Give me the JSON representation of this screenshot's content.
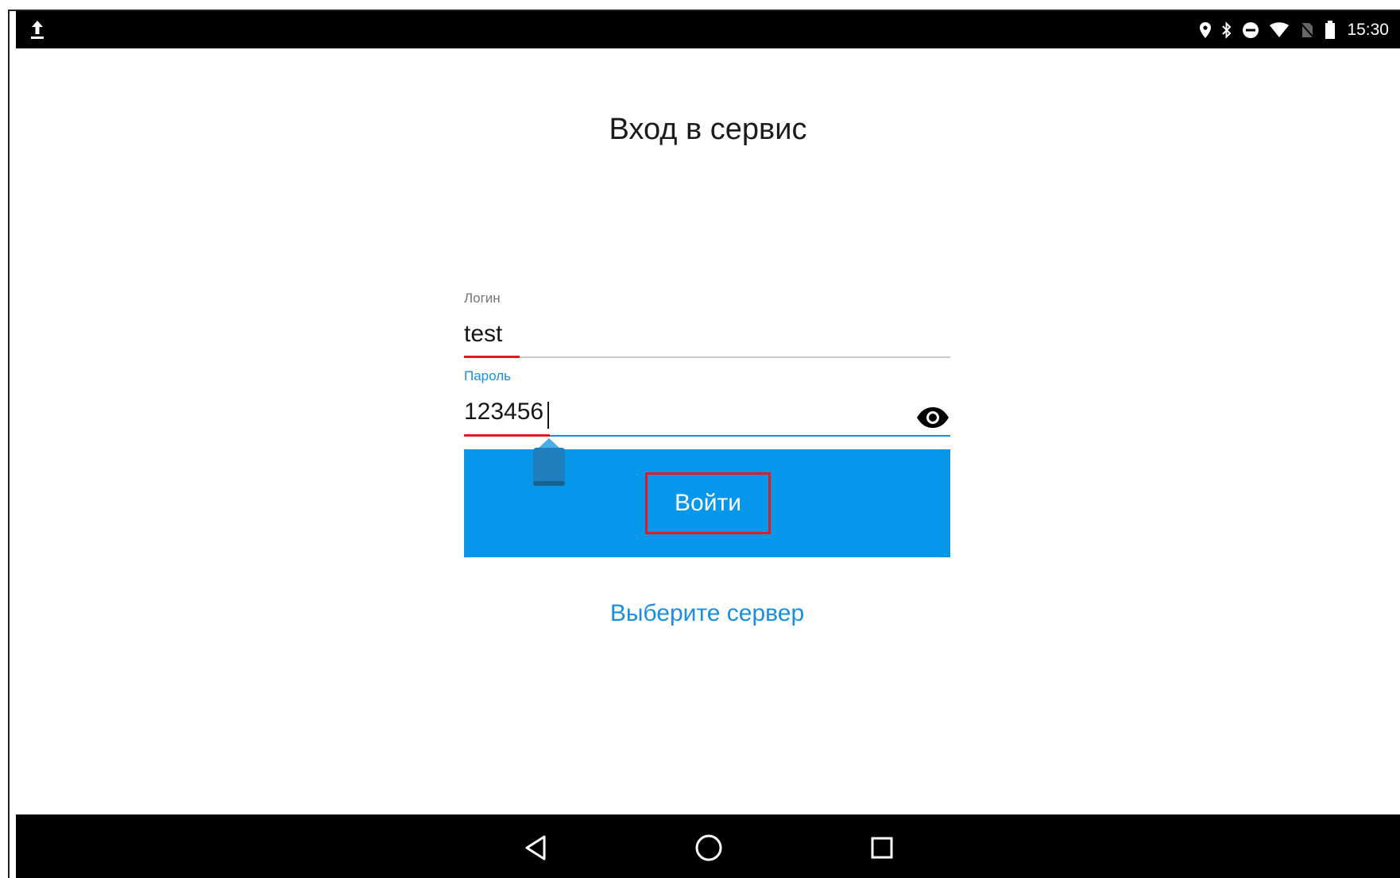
{
  "status_bar": {
    "time": "15:30",
    "icons": [
      "upload-icon",
      "location-icon",
      "bluetooth-icon",
      "do-not-disturb-icon",
      "wifi-icon",
      "no-sim-icon",
      "battery-icon"
    ]
  },
  "page": {
    "title": "Вход в сервис"
  },
  "form": {
    "login_label": "Логин",
    "login_value": "test",
    "password_label": "Пароль",
    "password_value": "123456",
    "submit_label": "Войти",
    "server_link": "Выберите сервер"
  },
  "nav_bar": {
    "icons": [
      "back-icon",
      "home-icon",
      "recent-apps-icon"
    ]
  },
  "colors": {
    "accent": "#0696ea",
    "link": "#1a8fe0",
    "highlight": "#e11b22",
    "bars": "#000000"
  }
}
